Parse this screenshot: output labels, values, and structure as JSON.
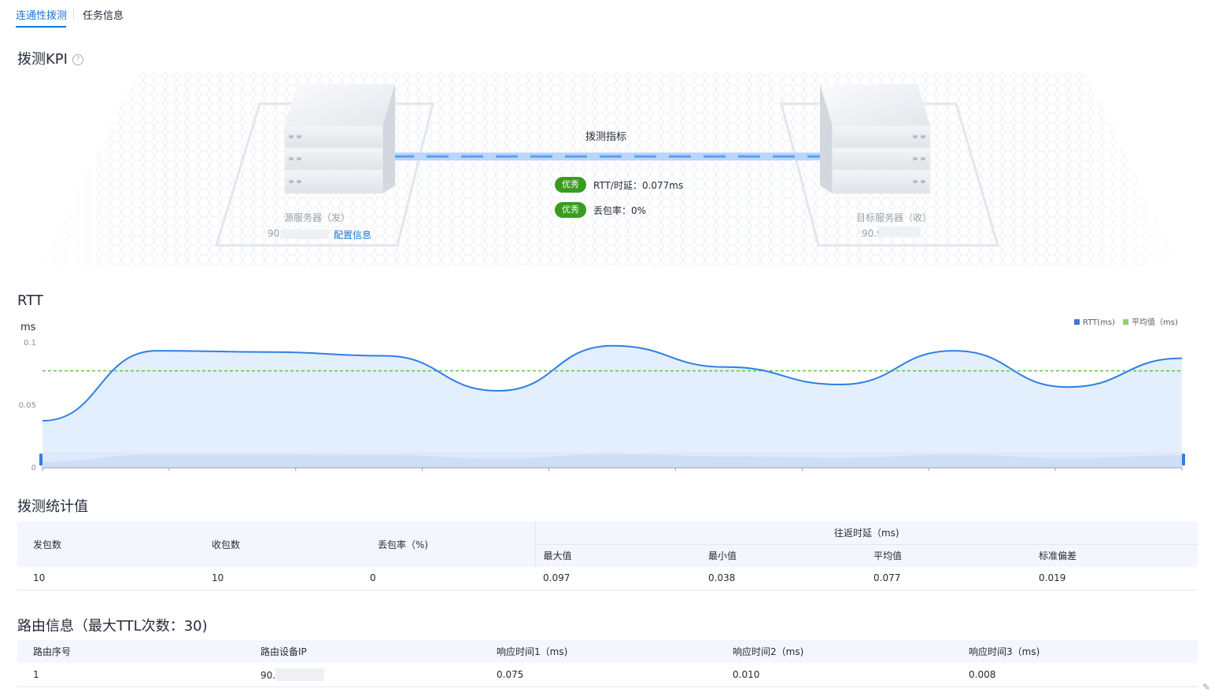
{
  "tabs": [
    {
      "label": "连通性拨测",
      "active": true
    },
    {
      "label": "任务信息",
      "active": false
    }
  ],
  "kpi": {
    "title": "拨测KPI",
    "help_icon": "question-circle-icon",
    "source": {
      "label": "源服务器（发）",
      "ip": "90",
      "config_link": "配置信息"
    },
    "target": {
      "label": "目标服务器（收）",
      "ip": "90.9"
    },
    "metric_title": "拨测指标",
    "metrics": [
      {
        "badge": "优秀",
        "text": "RTT/时延：0.077ms"
      },
      {
        "badge": "优秀",
        "text": "丢包率：0%"
      }
    ],
    "colors": {
      "badge": "#3a9b1f",
      "link": "#1976d2"
    }
  },
  "rtt": {
    "title": "RTT",
    "chart_data": {
      "type": "area",
      "ylabel": "ms",
      "yticks": [
        "0.1",
        "0.05",
        "0"
      ],
      "ylim": [
        0,
        0.1
      ],
      "series": [
        {
          "name": "RTT(ms)",
          "color": "#2e7fe6",
          "values": [
            0.037,
            0.093,
            0.092,
            0.089,
            0.061,
            0.097,
            0.08,
            0.066,
            0.093,
            0.064,
            0.087
          ]
        },
        {
          "name": "平均值（ms)",
          "color": "#5ac73c",
          "values": [
            0.077,
            0.077,
            0.077,
            0.077,
            0.077,
            0.077,
            0.077,
            0.077,
            0.077,
            0.077,
            0.077
          ]
        }
      ],
      "legend": "top-right",
      "grid": false,
      "datazoom_slider": true
    }
  },
  "stats": {
    "title": "拨测统计值",
    "headers": {
      "sent": "发包数",
      "received": "收包数",
      "loss": "丢包率（%)",
      "rtt_group": "往返时延（ms)",
      "max": "最大值",
      "min": "最小值",
      "avg": "平均值",
      "std": "标准偏差"
    },
    "row": {
      "sent": "10",
      "received": "10",
      "loss": "0",
      "max": "0.097",
      "min": "0.038",
      "avg": "0.077",
      "std": "0.019"
    }
  },
  "route": {
    "title": "路由信息（最大TTL次数：30)",
    "headers": [
      "路由序号",
      "路由设备IP",
      "响应时间1（ms)",
      "响应时间2（ms)",
      "响应时间3（ms)"
    ],
    "rows": [
      [
        "1",
        "90.",
        "0.075",
        "0.010",
        "0.008"
      ]
    ]
  }
}
